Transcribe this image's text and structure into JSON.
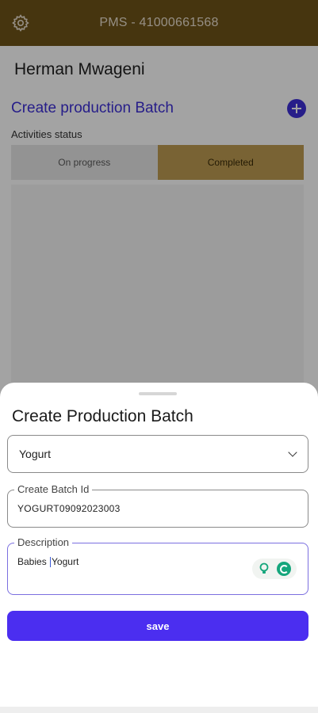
{
  "app_bar": {
    "title": "PMS - 41000661568",
    "icon": "gear-icon"
  },
  "user": {
    "name": "Herman Mwageni"
  },
  "section": {
    "title": "Create production Batch",
    "add_icon": "plus-circle-icon"
  },
  "activities": {
    "label": "Activities status",
    "tabs": [
      {
        "label": "On progress",
        "selected": false
      },
      {
        "label": "Completed",
        "selected": true
      }
    ]
  },
  "sheet": {
    "title": "Create Production Batch",
    "product_select": {
      "value": "Yogurt"
    },
    "batch_id": {
      "label": "Create Batch Id",
      "value": "YOGURT09092023003"
    },
    "description": {
      "label": "Description",
      "value_before_caret": "Babies ",
      "value_after_caret": "Yogurt"
    },
    "save_label": "save"
  },
  "colors": {
    "app_bar": "#6e5318",
    "accent": "#3d2fd6",
    "completed_tab": "#bd9c52",
    "save_button": "#4b2ef0"
  }
}
